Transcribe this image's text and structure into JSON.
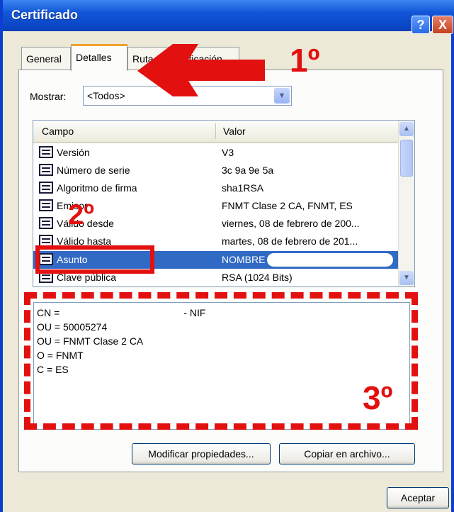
{
  "window": {
    "title": "Certificado",
    "help_label": "?",
    "close_label": "X"
  },
  "tabs": [
    {
      "label": "General",
      "active": false
    },
    {
      "label": "Detalles",
      "active": true
    },
    {
      "label": "Ruta de certificación",
      "active": false
    }
  ],
  "mostrar": {
    "label": "Mostrar:",
    "selected": "<Todos>"
  },
  "list": {
    "columns": [
      "Campo",
      "Valor"
    ],
    "rows": [
      {
        "campo": "Versión",
        "valor": "V3"
      },
      {
        "campo": "Número de serie",
        "valor": "3c 9a 9e 5a"
      },
      {
        "campo": "Algoritmo de firma",
        "valor": "sha1RSA"
      },
      {
        "campo": "Emisor",
        "valor": "FNMT Clase 2 CA, FNMT, ES"
      },
      {
        "campo": "Válido desde",
        "valor": "viernes, 08 de febrero de 200..."
      },
      {
        "campo": "Válido hasta",
        "valor": "martes, 08 de febrero de 201..."
      },
      {
        "campo": "Asunto",
        "valor": "NOMBRE",
        "selected": true
      },
      {
        "campo": "Clave pública",
        "valor": "RSA (1024 Bits)"
      }
    ]
  },
  "detail_lines": [
    "CN =                                             - NIF",
    "OU = 50005274",
    "OU = FNMT Clase 2 CA",
    "O = FNMT",
    "C = ES"
  ],
  "buttons": {
    "modificar": "Modificar propiedades...",
    "copiar": "Copiar en archivo...",
    "aceptar": "Aceptar"
  },
  "annotations": {
    "step1": "1º",
    "step2": "2º",
    "step3": "3º",
    "color": "#e31010"
  }
}
